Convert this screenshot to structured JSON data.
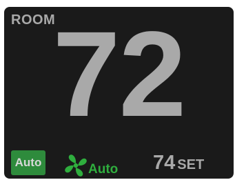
{
  "room": {
    "label": "ROOM",
    "temperature": "72"
  },
  "controls": {
    "mode_label": "Auto",
    "fan_label": "Auto",
    "fan_icon": "fan-icon",
    "setpoint_value": "74",
    "setpoint_label": "SET"
  },
  "colors": {
    "background": "#1a1a1a",
    "text_gray": "#a9a9a9",
    "mode_button_green": "#2e8b3c",
    "fan_green": "#2fae3e"
  }
}
